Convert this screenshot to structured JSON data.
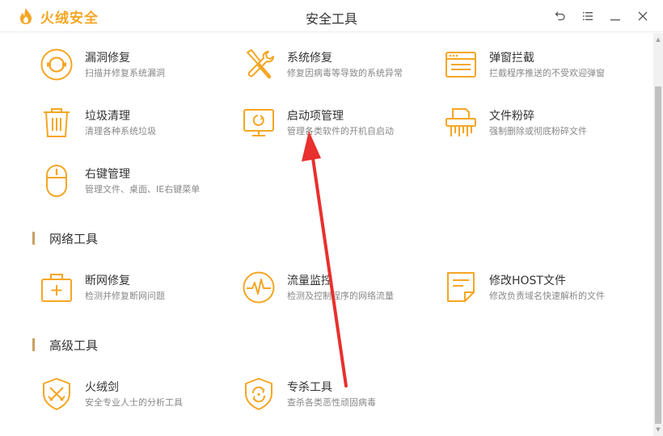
{
  "app": {
    "name": "火绒安全",
    "window_title": "安全工具"
  },
  "window_controls": {
    "back_icon": "undo-arrow-icon",
    "menu_icon": "menu-lines-icon",
    "minimize_icon": "minimize-icon",
    "close_icon": "close-icon"
  },
  "colors": {
    "accent": "#f5a623",
    "section_bar": "#c9a063",
    "annotation_arrow": "#e8302e"
  },
  "system_tools": [
    {
      "name": "漏洞修复",
      "desc": "扫描并修复系统漏洞",
      "icon": "vulnerability-repair-icon"
    },
    {
      "name": "系统修复",
      "desc": "修复因病毒等导致的系统异常",
      "icon": "wrench-screwdriver-icon"
    },
    {
      "name": "弹窗拦截",
      "desc": "拦截程序推送的不受欢迎弹窗",
      "icon": "popup-window-icon"
    },
    {
      "name": "垃圾清理",
      "desc": "清理各种系统垃圾",
      "icon": "trash-can-icon"
    },
    {
      "name": "启动项管理",
      "desc": "管理各类软件的开机自启动",
      "icon": "monitor-startup-icon"
    },
    {
      "name": "文件粉碎",
      "desc": "强制删除或彻底粉碎文件",
      "icon": "file-shredder-icon"
    },
    {
      "name": "右键管理",
      "desc": "管理文件、桌面、IE右键菜单",
      "icon": "mouse-icon"
    }
  ],
  "network_section": {
    "title": "网络工具"
  },
  "network_tools": [
    {
      "name": "断网修复",
      "desc": "检测并修复断网问题",
      "icon": "first-aid-kit-icon"
    },
    {
      "name": "流量监控",
      "desc": "检测及控制程序的网络流量",
      "icon": "traffic-monitor-icon"
    },
    {
      "name": "修改HOST文件",
      "desc": "修改负责域名快速解析的文件",
      "icon": "host-file-icon"
    }
  ],
  "advanced_section": {
    "title": "高级工具"
  },
  "advanced_tools": [
    {
      "name": "火绒剑",
      "desc": "安全专业人士的分析工具",
      "icon": "shield-swords-icon"
    },
    {
      "name": "专杀工具",
      "desc": "查杀各类恶性顽固病毒",
      "icon": "shield-refresh-icon"
    }
  ],
  "scrollbar": {
    "up_icon": "scroll-up-arrow-icon",
    "down_icon": "scroll-down-arrow-icon"
  },
  "annotation": {
    "icon": "red-annotation-arrow-icon"
  }
}
